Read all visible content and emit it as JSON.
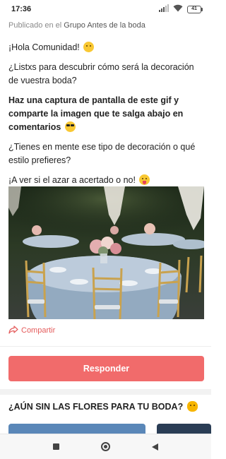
{
  "status_bar": {
    "time": "17:36",
    "battery_level": "41",
    "icons": [
      "signal-icon",
      "wifi-icon",
      "battery-icon"
    ]
  },
  "post": {
    "published_prefix": "Publicado en el",
    "published_group": "Grupo Antes de la boda",
    "paragraphs": [
      {
        "text": "¡Hola Comunidad!",
        "emoji": "smile-emoji",
        "bold": false
      },
      {
        "text": "¿Listxs para descubrir cómo será la decoración de vuestra boda?",
        "emoji": "",
        "bold": false
      },
      {
        "text": "Haz una captura de pantalla de este gif y comparte la imagen que te salga abajo en comentarios",
        "emoji": "sunglasses-emoji",
        "bold": true
      },
      {
        "text": "¿Tienes en mente ese tipo de decoración o qué estilo prefieres?",
        "emoji": "",
        "bold": false
      },
      {
        "text": "¡A ver si el azar a acertado o no!",
        "emoji": "tongue-emoji",
        "bold": false
      }
    ],
    "image_alt": "wedding-reception-photo",
    "share_label": "Compartir"
  },
  "actions": {
    "reply_label": "Responder"
  },
  "promo": {
    "title": "¿AÚN SIN LAS FLORES PARA TU BODA?",
    "title_emoji": "sunflower-emoji"
  },
  "colors": {
    "accent": "#f16b6b",
    "share_text": "#e45b5b",
    "muted_text": "#8a8a8a",
    "divider": "#eeeeee"
  },
  "nav_bar": {
    "buttons": [
      "recent-apps-icon",
      "home-icon",
      "back-icon"
    ]
  }
}
